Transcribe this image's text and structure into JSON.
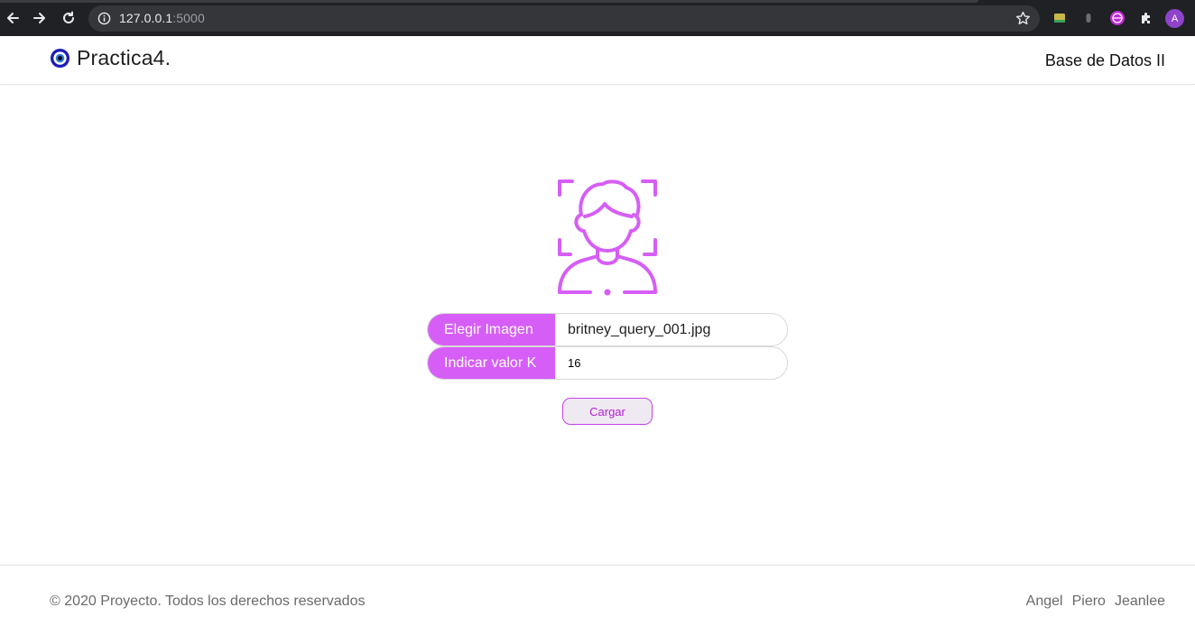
{
  "browser": {
    "url_host": "127.0.0.1",
    "url_port": ":5000",
    "profile_initial": "A"
  },
  "header": {
    "brand": "Practica4.",
    "right_title": "Base de Datos II"
  },
  "form": {
    "image_label": "Elegir Imagen",
    "image_value": "britney_query_001.jpg",
    "k_label": "Indicar valor K",
    "k_value": "16",
    "submit_label": "Cargar"
  },
  "footer": {
    "copyright": "© 2020 Proyecto. Todos los derechos reservados",
    "authors": [
      "Angel",
      "Piero",
      "Jeanlee"
    ]
  },
  "colors": {
    "accent": "#d65ef6",
    "button_text": "#b31fd9",
    "brand_logo": "#1d1db8"
  },
  "icons": {
    "main": "face-scan-icon",
    "brand": "eye-logo-icon"
  }
}
